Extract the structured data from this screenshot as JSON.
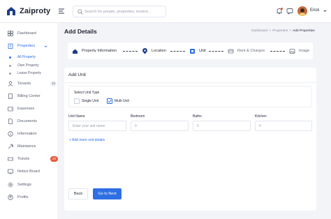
{
  "brand": {
    "name": "Zaiproty"
  },
  "header": {
    "search_placeholder": "Search for people, properties, invoice...",
    "user_name": "Erick",
    "icons": [
      "menu-icon",
      "search-icon",
      "bell-icon",
      "chat-icon",
      "chevron-down-icon"
    ]
  },
  "sidebar": {
    "items": [
      {
        "label": "Dashboard",
        "icon": "grid-icon"
      },
      {
        "label": "Properties",
        "icon": "building-icon",
        "active": true
      },
      {
        "label": "Tenants",
        "icon": "user-icon",
        "count": "15"
      },
      {
        "label": "Billing Center",
        "icon": "receipt-icon"
      },
      {
        "label": "Expenses",
        "icon": "wallet-icon"
      },
      {
        "label": "Documents",
        "icon": "file-icon"
      },
      {
        "label": "Information",
        "icon": "info-icon"
      },
      {
        "label": "Maintaince",
        "icon": "wrench-icon"
      },
      {
        "label": "Tickets",
        "icon": "ticket-icon",
        "alert": "20"
      },
      {
        "label": "Notice Board",
        "icon": "board-icon"
      },
      {
        "label": "Settings",
        "icon": "gear-icon"
      },
      {
        "label": "Profile",
        "icon": "user-circle-icon"
      }
    ],
    "sub_items": [
      {
        "label": "All Property",
        "active": true
      },
      {
        "label": "Own Property"
      },
      {
        "label": "Lease Property"
      }
    ]
  },
  "page": {
    "title": "Add Details",
    "breadcrumb": [
      "Dashboard",
      "Properties",
      "Add Properties"
    ],
    "breadcrumb_sep": ">"
  },
  "steps": [
    {
      "label": "Property  Information",
      "state": "done"
    },
    {
      "label": "Location",
      "state": "done"
    },
    {
      "label": "Unit",
      "state": "current"
    },
    {
      "label": "Rent & Charges",
      "state": "pending"
    },
    {
      "label": "Image",
      "state": "pending"
    }
  ],
  "form": {
    "section_title": "Add Unit",
    "unit_type_label": "Select Unit Type",
    "unit_type_options": [
      {
        "label": "Single Unit",
        "checked": false
      },
      {
        "label": "Multi Unit",
        "checked": true
      }
    ],
    "fields": [
      {
        "label": "Unit Name",
        "placeholder": "Enter your unit name"
      },
      {
        "label": "Bedroom",
        "placeholder": "0"
      },
      {
        "label": "Baths",
        "placeholder": "0"
      },
      {
        "label": "Kitchen",
        "placeholder": "0"
      }
    ],
    "add_more": "+ Add more unit details",
    "back_label": "Back",
    "next_label": "Go to Next"
  },
  "colors": {
    "accent": "#2f6fe4",
    "alert": "#e85a3c",
    "background": "#f3f4f8"
  }
}
